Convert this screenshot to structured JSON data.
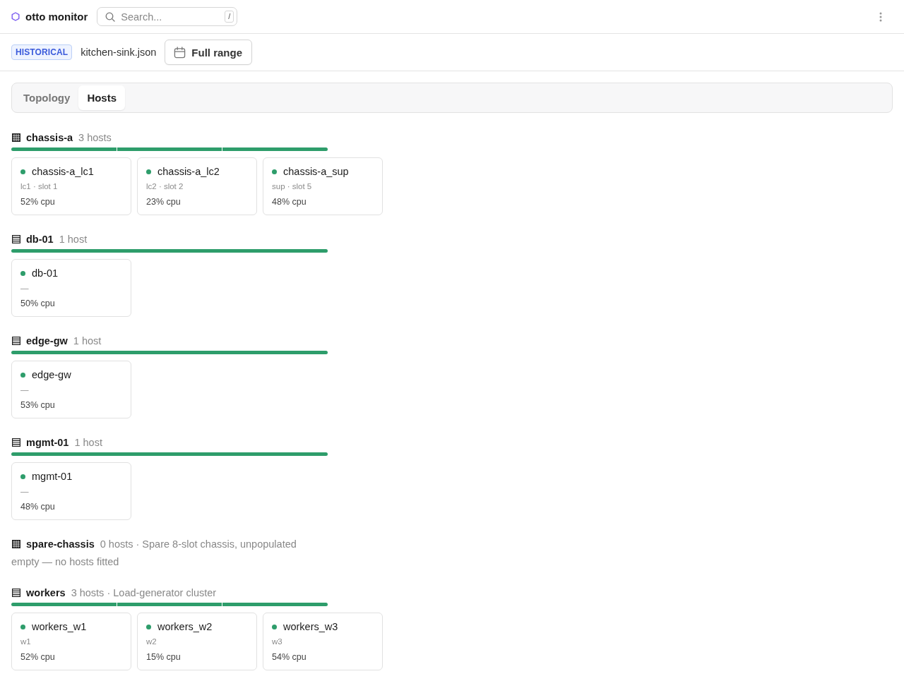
{
  "app": {
    "title": "otto monitor"
  },
  "search": {
    "placeholder": "Search...",
    "shortcut": "/"
  },
  "toolbar": {
    "mode_badge": "HISTORICAL",
    "file": "kitchen-sink.json",
    "range_button": "Full range"
  },
  "tabs": [
    {
      "label": "Topology",
      "selected": false
    },
    {
      "label": "Hosts",
      "selected": true
    }
  ],
  "groups": [
    {
      "name": "chassis-a",
      "kind": "chassis",
      "meta": "3 hosts",
      "hosts": [
        {
          "name": "chassis-a_lc1",
          "color": "#2e9d6b",
          "detail": "lc1 · slot 1",
          "cpu": "52% cpu"
        },
        {
          "name": "chassis-a_lc2",
          "color": "#2e9d6b",
          "detail": "lc2 · slot 2",
          "cpu": "23% cpu"
        },
        {
          "name": "chassis-a_sup",
          "color": "#2e9d6b",
          "detail": "sup · slot 5",
          "cpu": "48% cpu"
        }
      ]
    },
    {
      "name": "db-01",
      "kind": "host",
      "meta": "1 host",
      "hosts": [
        {
          "name": "db-01",
          "color": "#2e9d6b",
          "detail": "—",
          "cpu": "50% cpu"
        }
      ]
    },
    {
      "name": "edge-gw",
      "kind": "host",
      "meta": "1 host",
      "hosts": [
        {
          "name": "edge-gw",
          "color": "#2e9d6b",
          "detail": "—",
          "cpu": "53% cpu"
        }
      ]
    },
    {
      "name": "mgmt-01",
      "kind": "host",
      "meta": "1 host",
      "hosts": [
        {
          "name": "mgmt-01",
          "color": "#2e9d6b",
          "detail": "—",
          "cpu": "48% cpu"
        }
      ]
    },
    {
      "name": "spare-chassis",
      "kind": "chassis",
      "meta": "0 hosts · Spare 8-slot chassis, unpopulated",
      "empty_text": "empty — no hosts fitted"
    },
    {
      "name": "workers",
      "kind": "host",
      "meta": "3 hosts · Load-generator cluster",
      "hosts": [
        {
          "name": "workers_w1",
          "color": "#2e9d6b",
          "detail": "w1",
          "cpu": "52% cpu"
        },
        {
          "name": "workers_w2",
          "color": "#2e9d6b",
          "detail": "w2",
          "cpu": "15% cpu"
        },
        {
          "name": "workers_w3",
          "color": "#2e9d6b",
          "detail": "w3",
          "cpu": "54% cpu"
        }
      ]
    }
  ]
}
